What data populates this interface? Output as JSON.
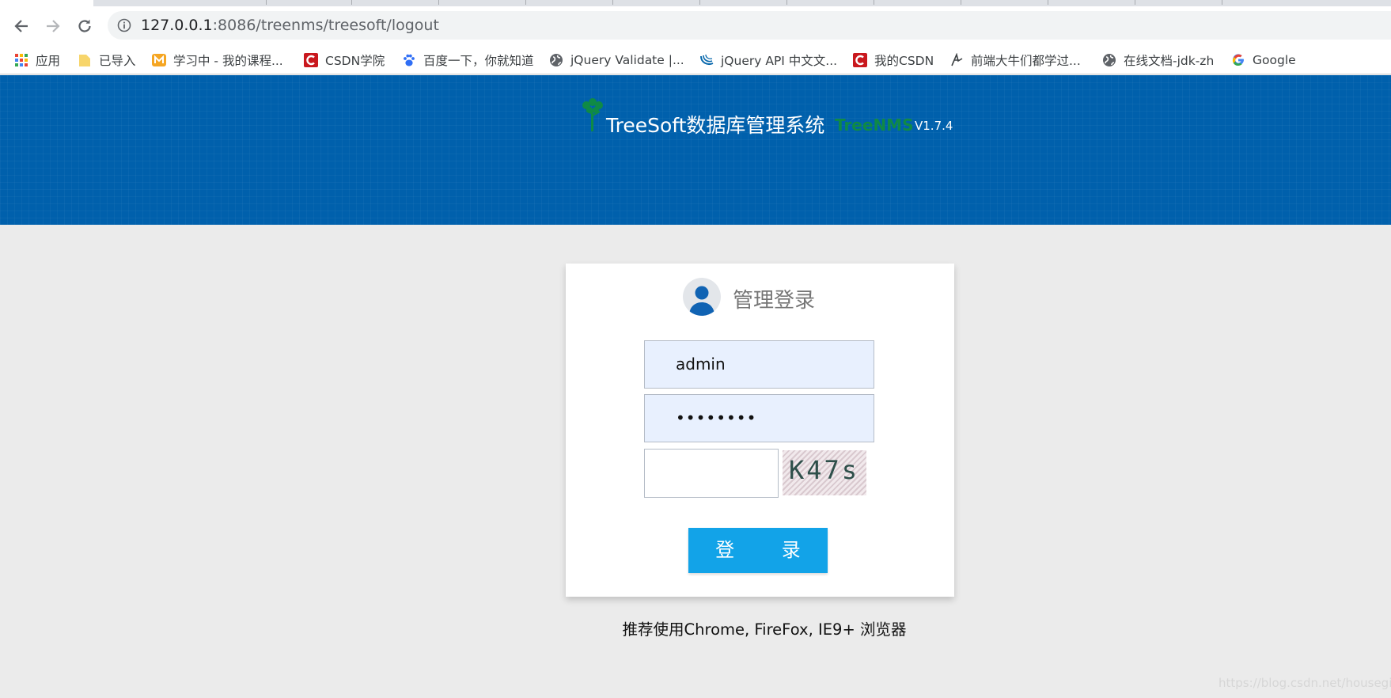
{
  "browser": {
    "url_host": "127.0.0.1",
    "url_rest": ":8086/treenms/treesoft/logout",
    "bookmarks": [
      {
        "label": "应用",
        "icon": "apps-grid-icon"
      },
      {
        "label": "已导入",
        "icon": "folder-icon"
      },
      {
        "label": "学习中 - 我的课程...",
        "icon": "mooc-icon"
      },
      {
        "label": "CSDN学院",
        "icon": "csdn-icon"
      },
      {
        "label": "百度一下，你就知道",
        "icon": "baidu-paw-icon"
      },
      {
        "label": "jQuery Validate |...",
        "icon": "globe-icon"
      },
      {
        "label": "jQuery API 中文文...",
        "icon": "jquery-icon"
      },
      {
        "label": "我的CSDN",
        "icon": "csdn-icon"
      },
      {
        "label": "前端大牛们都学过...",
        "icon": "bird-icon"
      },
      {
        "label": "在线文档-jdk-zh",
        "icon": "globe-icon"
      },
      {
        "label": "Google",
        "icon": "google-icon"
      }
    ]
  },
  "header": {
    "title": "TreeSoft数据库管理系统",
    "subtitle": "TreeNMS",
    "version": "V1.7.4"
  },
  "login": {
    "title": "管理登录",
    "username": "admin",
    "password_mask": "••••••••",
    "captcha_text": "K47s",
    "submit_label": "登 录"
  },
  "footer": {
    "note": "推荐使用Chrome, FireFox, IE9+ 浏览器",
    "watermark": "https://blog.csdn.net/housegirl"
  },
  "colors": {
    "banner": "#0060ac",
    "button": "#12a3e8",
    "subtitle": "#0f8a46",
    "background": "#ebebeb"
  }
}
